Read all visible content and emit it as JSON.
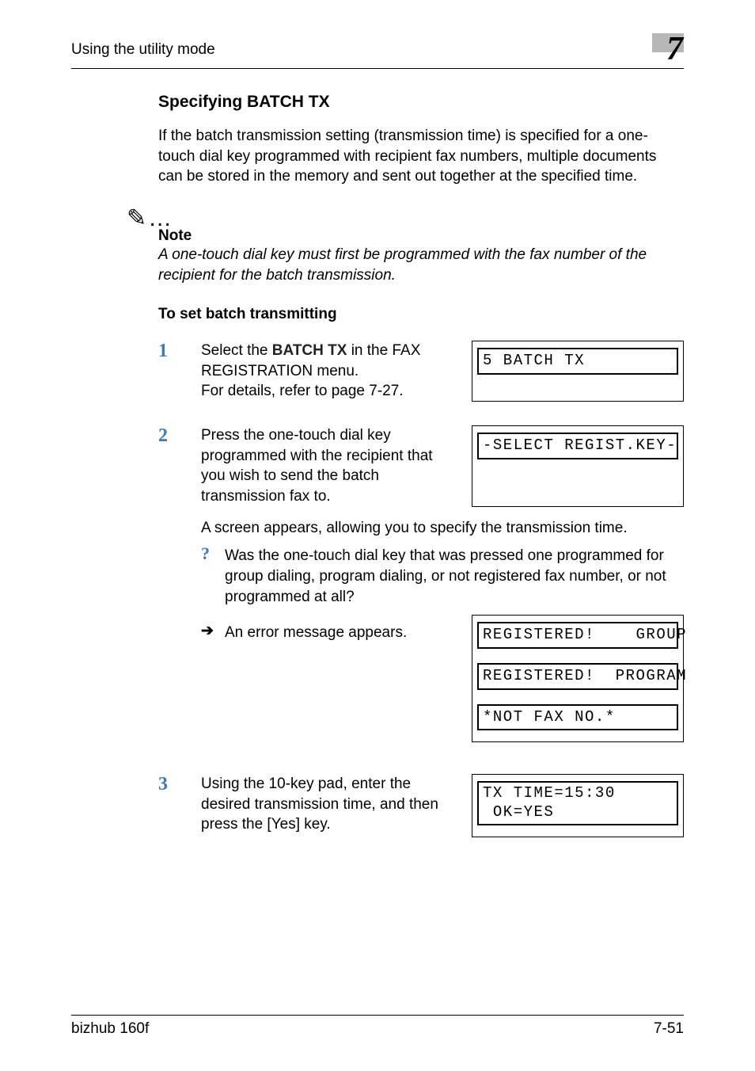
{
  "header": {
    "running_head": "Using the utility mode",
    "chapter_number": "7"
  },
  "section": {
    "title": "Specifying BATCH TX",
    "intro": "If the batch transmission setting (transmission time) is specified for a one-touch dial key programmed with recipient fax numbers, multiple documents can be stored in the memory and sent out together at the specified time."
  },
  "note": {
    "icon": "✎…",
    "label": "Note",
    "text": "A one-touch dial key must first be programmed with the fax number of the recipient for the batch transmission."
  },
  "procedure": {
    "title": "To set batch transmitting",
    "steps": [
      {
        "num": "1",
        "text_before": "Select the ",
        "bold": "BATCH TX",
        "text_after": " in the FAX REGISTRATION menu.",
        "line2": "For details, refer to page 7-27.",
        "lcd": [
          "5 BATCH TX"
        ]
      },
      {
        "num": "2",
        "text": "Press the one-touch dial key programmed with the recipient that you wish to send the batch transmission fax to.",
        "lcd": [
          "-SELECT REGIST.KEY-"
        ],
        "after": "A screen appears, allowing you to specify the transmission time.",
        "q": "Was the one-touch dial key that was pressed one programmed for group dialing, program dialing, or not registered fax number, or not programmed at all?",
        "a": "An error message appears.",
        "error_lcd": [
          "REGISTERED!    GROUP",
          "REGISTERED!  PROGRAM",
          "*NOT FAX NO.*"
        ]
      },
      {
        "num": "3",
        "text": "Using the 10-key pad, enter the desired transmission time, and then press the [Yes] key.",
        "lcd_two": "TX TIME=15:30\n OK=YES"
      }
    ]
  },
  "footer": {
    "product": "bizhub 160f",
    "page": "7-51"
  }
}
